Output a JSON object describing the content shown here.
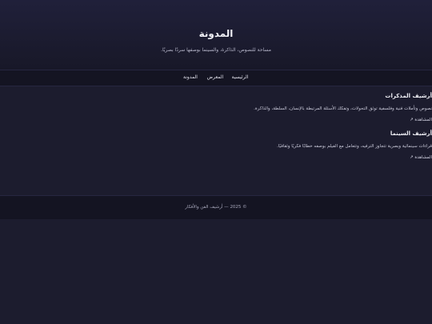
{
  "header": {
    "title": "المدونة",
    "tagline": "مساحة للنصوص، الذاكرة، والسينما بوصفها سردًا بصريًا."
  },
  "nav": {
    "home": "الرئيسية",
    "gallery": "المعرض",
    "blog": "المدونة"
  },
  "sections": [
    {
      "title": "أرشيف المذكرات",
      "description": "نصوص وتأملات فنية وفلسفية توثق التحولات، وتفكك الأسئلة المرتبطة بالإنسان، السلطة، والذاكرة.",
      "link": "المشاهدة ↗"
    },
    {
      "title": "أرشيف السينما",
      "description": "قراءات سينمائية وبصرية تتجاوز الترفيه، وتتعامل مع الفيلم بوصفه خطابًا فكريًا وثقافيًا.",
      "link": "المشاهدة ↗"
    }
  ],
  "footer": {
    "text": "© 2025 — أرشيف الفن والأفكار"
  },
  "colors": {
    "background": "#1c1c2e",
    "header_gradient_top": "#20203a",
    "nav_background": "#141422",
    "text": "#d8d8e4"
  }
}
